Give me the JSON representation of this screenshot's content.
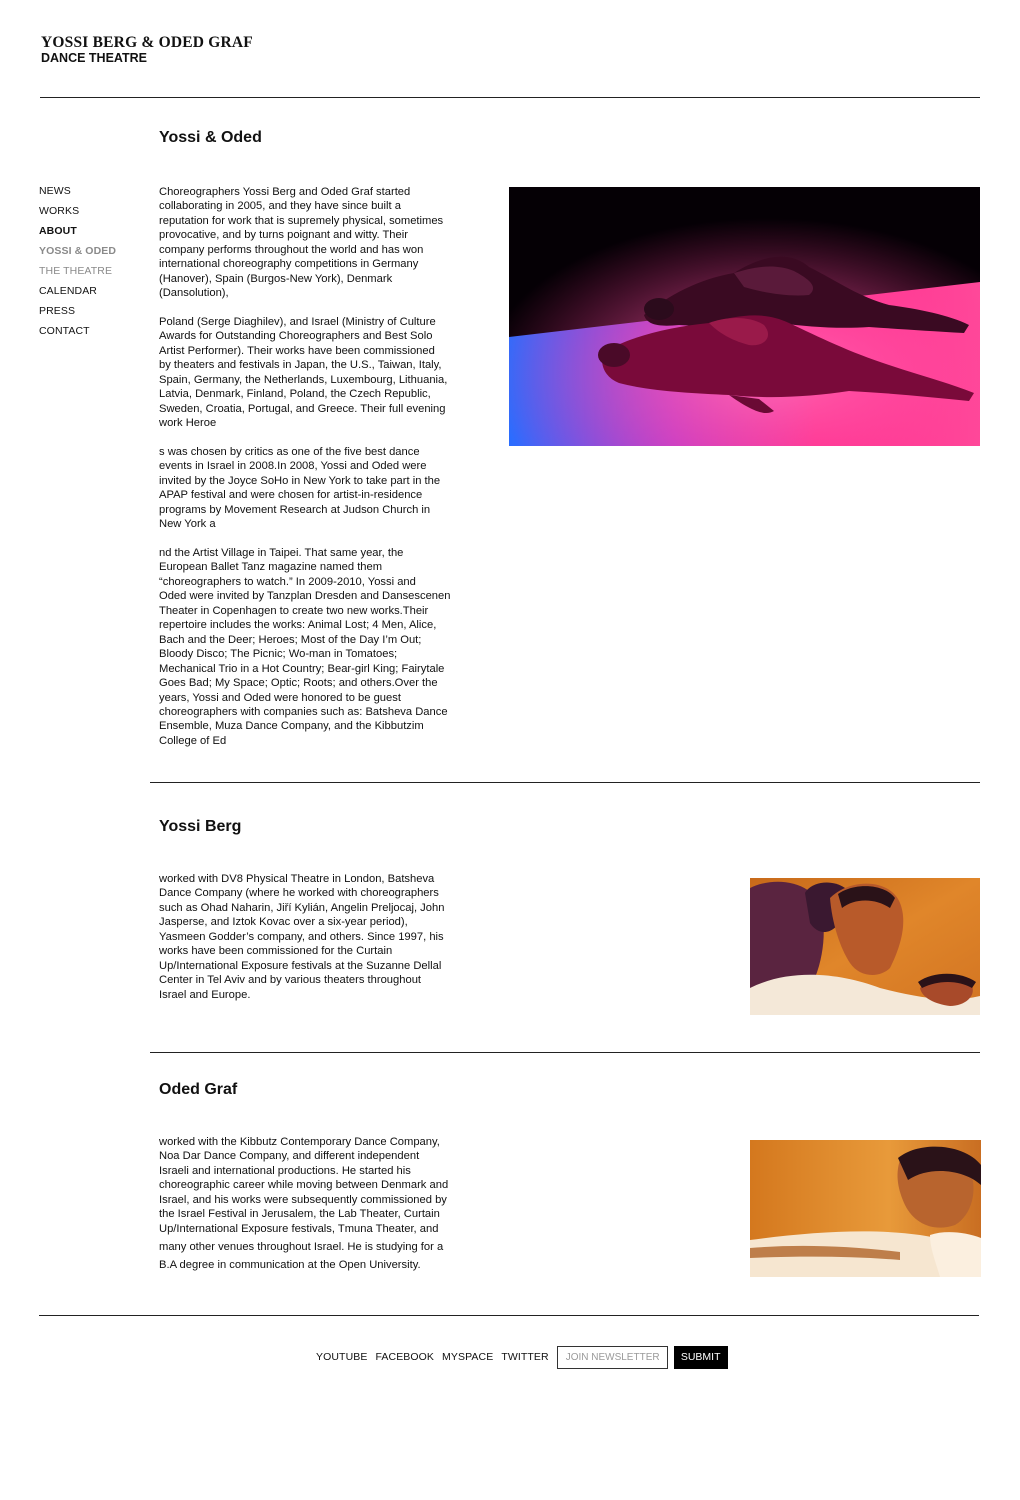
{
  "header": {
    "title": "YOSSI BERG & ODED GRAF",
    "subtitle": "DANCE THEATRE"
  },
  "nav": {
    "items": [
      {
        "label": "NEWS"
      },
      {
        "label": "WORKS"
      },
      {
        "label": "ABOUT"
      },
      {
        "label": "YOSSI & ODED"
      },
      {
        "label": "THE THEATRE"
      },
      {
        "label": "CALENDAR"
      },
      {
        "label": "PRESS"
      },
      {
        "label": "CONTACT"
      }
    ]
  },
  "sections": {
    "duo": {
      "heading": "Yossi & Oded",
      "paragraphs": [
        "Choreographers Yossi Berg and Oded Graf started\ncollaborating in 2005, and they have since built a\nreputation for work that is supremely physical, sometimes\nprovocative, and by turns poignant and witty. Their\ncompany performs throughout the world and has won\ninternational choreography competitions in Germany\n(Hanover), Spain (Burgos-New York), Denmark\n(Dansolution),",
        "Poland (Serge Diaghilev), and Israel (Ministry of Culture\nAwards for Outstanding Choreographers and Best Solo\nArtist Performer).  Their works have been commissioned\nby theaters and festivals in Japan, the U.S., Taiwan, Italy,\nSpain, Germany, the Netherlands, Luxembourg, Lithuania,\nLatvia, Denmark, Finland, Poland, the Czech Republic,\nSweden, Croatia, Portugal, and Greece.  Their full evening\nwork Heroe",
        "s was chosen by critics as one of the five best dance\nevents in Israel in 2008.In 2008, Yossi and Oded were\ninvited by the Joyce SoHo in New York to take part in the\nAPAP festival and were chosen for artist-in-residence\nprograms by Movement Research at Judson Church in\nNew York a",
        "nd the Artist Village in Taipei.  That same year, the\nEuropean Ballet Tanz magazine named them\n“choreographers to watch.”  In 2009-2010, Yossi and\nOded were invited by Tanzplan Dresden and Dansescenen\nTheater in Copenhagen to create two new works.Their\nrepertoire includes the works: Animal Lost; 4 Men, Alice,\nBach and the Deer; Heroes; Most of the Day I’m Out;\nBloody Disco; The Picnic; Wo-man in Tomatoes;\nMechanical Trio in a Hot Country; Bear-girl King; Fairytale\nGoes Bad; My Space; Optic; Roots; and others.Over the\nyears, Yossi and Oded were honored to be guest\nchoreographers with companies such as: Batsheva Dance\nEnsemble, Muza Dance Company, and the Kibbutzim\nCollege of Ed"
      ]
    },
    "yossi": {
      "heading": "Yossi Berg",
      "text": "worked with DV8 Physical Theatre in London, Batsheva\nDance Company (where he worked with choreographers\nsuch as Ohad Naharin, Jiří Kylián, Angelin Preljocaj, John\nJasperse, and Iztok Kovac over a six-year period),\nYasmeen Godder’s company, and others.  Since 1997, his\nworks have been commissioned for the Curtain\nUp/International Exposure festivals at the Suzanne Dellal\nCenter in Tel Aviv and by various theaters throughout\nIsrael and Europe."
    },
    "oded": {
      "heading": "Oded Graf",
      "text": "worked with the Kibbutz Contemporary Dance Company,\nNoa Dar Dance Company, and different independent\nIsraeli and international productions. He started his\nchoreographic career while moving between Denmark and\nIsrael, and his works were subsequently commissioned by\nthe Israel Festival in Jerusalem, the Lab Theater, Curtain\nUp/International Exposure festivals, Tmuna Theater, and",
      "text2": "many other venues throughout Israel.  He is studying for a\nB.A degree in communication at the Open University."
    }
  },
  "footer": {
    "links": [
      "YOUTUBE",
      "FACEBOOK",
      "MYSPACE",
      "TWITTER"
    ],
    "newsletter_placeholder": "JOIN NEWSLETTER",
    "submit_label": "SUBMIT"
  }
}
